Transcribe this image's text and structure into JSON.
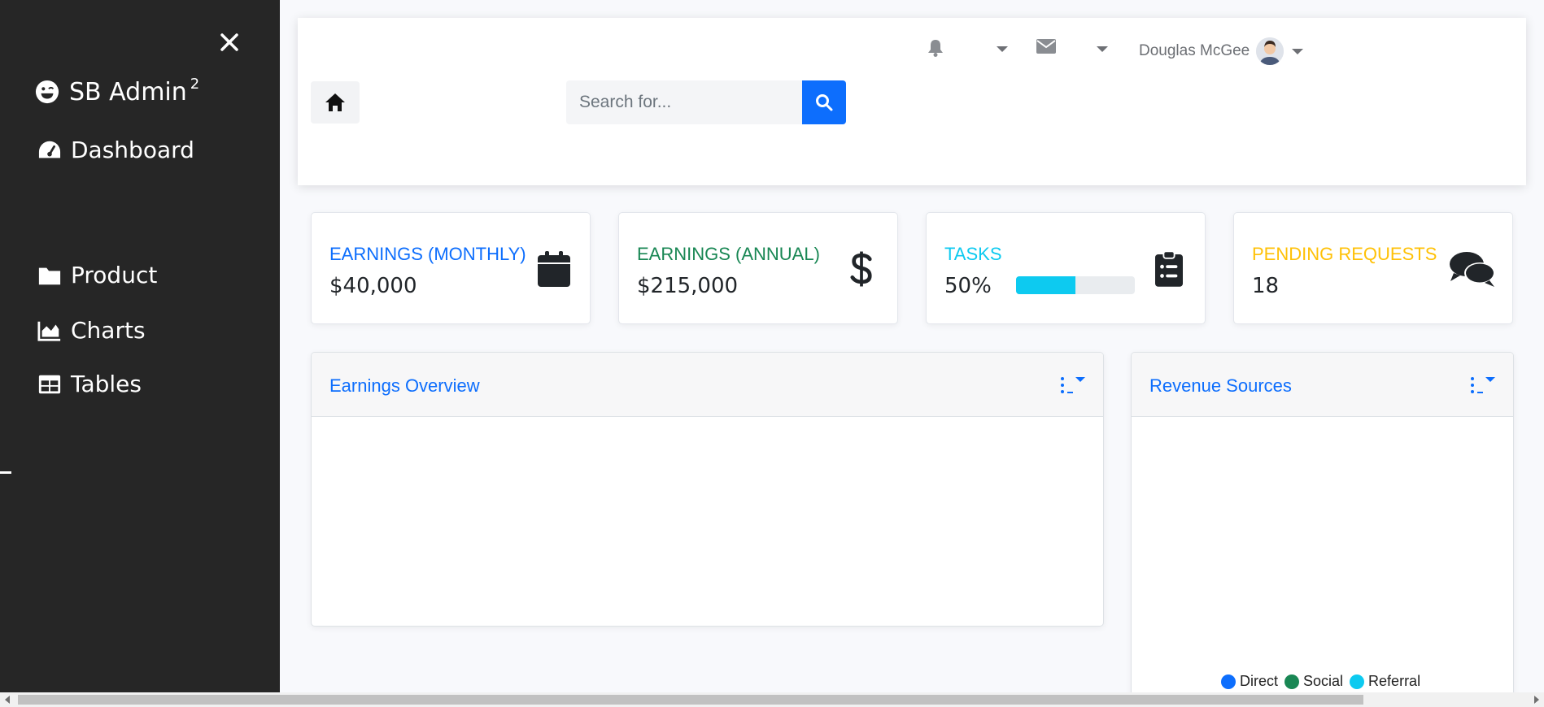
{
  "sidebar": {
    "brand": "SB Admin",
    "brand_sup": "2",
    "items": [
      {
        "label": "Dashboard",
        "icon": "gauge-icon"
      },
      {
        "label": "Product",
        "icon": "folder-icon"
      },
      {
        "label": "Charts",
        "icon": "area-chart-icon"
      },
      {
        "label": "Tables",
        "icon": "table-icon"
      }
    ]
  },
  "topbar": {
    "search_placeholder": "Search for...",
    "user_name": "Douglas McGee"
  },
  "cards": [
    {
      "label": "EARNINGS (MONTHLY)",
      "value": "$40,000",
      "icon": "calendar-icon",
      "color": "#0d6efd"
    },
    {
      "label": "EARNINGS (ANNUAL)",
      "value": "$215,000",
      "icon": "dollar-icon",
      "color": "#198754"
    },
    {
      "label": "TASKS",
      "value": "50%",
      "progress": 0.5,
      "icon": "clipboard-list-icon",
      "color": "#0dcaf0"
    },
    {
      "label": "PENDING REQUESTS",
      "value": "18",
      "icon": "comments-icon",
      "color": "#ffc107"
    }
  ],
  "panels": {
    "earnings": {
      "title": "Earnings Overview"
    },
    "revenue": {
      "title": "Revenue Sources",
      "legend": [
        {
          "label": "Direct",
          "color": "#0d6efd"
        },
        {
          "label": "Social",
          "color": "#198754"
        },
        {
          "label": "Referral",
          "color": "#0dcaf0"
        }
      ]
    }
  },
  "colors": {
    "sidebar_bg": "#262626",
    "primary": "#0d6efd"
  }
}
